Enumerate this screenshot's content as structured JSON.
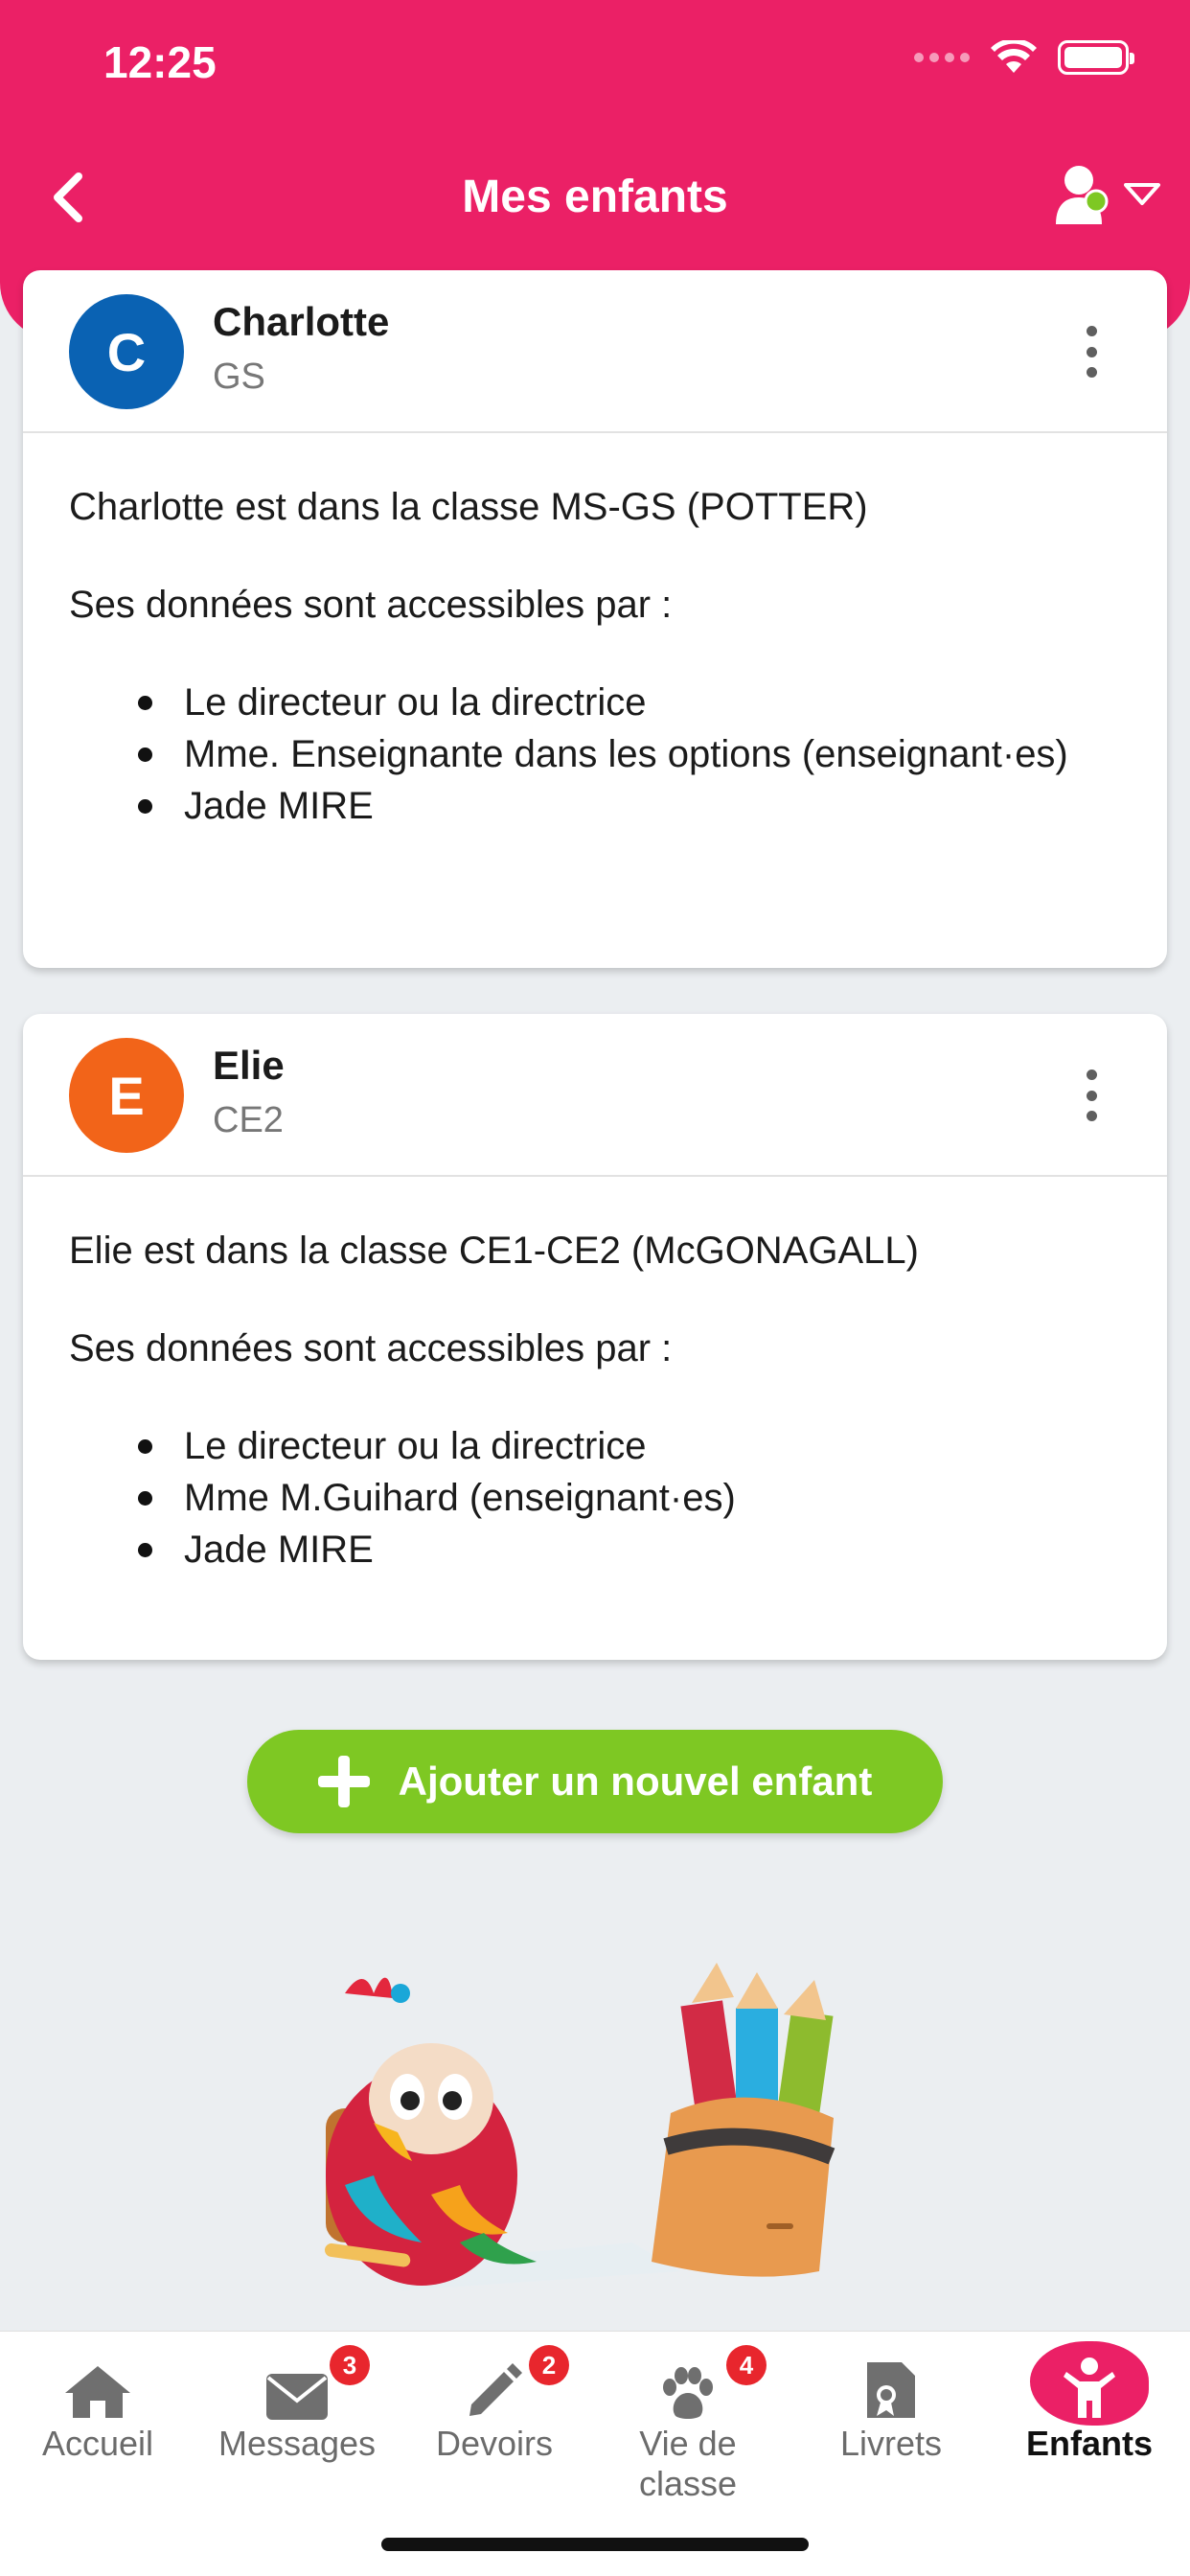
{
  "status_bar": {
    "time": "12:25"
  },
  "header": {
    "title": "Mes enfants",
    "back_icon": "chevron-left-icon",
    "profile_icon": "user-switch-icon"
  },
  "children": [
    {
      "initial": "C",
      "name": "Charlotte",
      "level": "GS",
      "avatar_color": "#0a62b3",
      "class_text": "Charlotte est dans la classe MS-GS (POTTER)",
      "access_title": "Ses données sont accessibles par :",
      "access_list": [
        "Le directeur ou la directrice",
        "Mme. Enseignante dans les options (enseignant·es)",
        "Jade MIRE"
      ]
    },
    {
      "initial": "E",
      "name": "Elie",
      "level": "CE2",
      "avatar_color": "#f26419",
      "class_text": "Elie est dans la classe CE1-CE2 (McGONAGALL)",
      "access_title": "Ses données sont accessibles par :",
      "access_list": [
        "Le directeur ou la directrice",
        "Mme M.Guihard (enseignant·es)",
        "Jade MIRE"
      ]
    }
  ],
  "add_button": {
    "label": "Ajouter un nouvel enfant",
    "color": "#7ec823"
  },
  "tabs": [
    {
      "label": "Accueil",
      "icon": "home-icon",
      "badge": ""
    },
    {
      "label": "Messages",
      "icon": "envelope-icon",
      "badge": "3"
    },
    {
      "label": "Devoirs",
      "icon": "pencil-icon",
      "badge": "2"
    },
    {
      "label": "Vie de classe",
      "icon": "paw-icon",
      "badge": "4"
    },
    {
      "label": "Livrets",
      "icon": "document-icon",
      "badge": ""
    },
    {
      "label": "Enfants",
      "icon": "child-icon",
      "badge": "",
      "active": true
    }
  ],
  "colors": {
    "brand": "#eb2066",
    "badge": "#e8262d",
    "background": "#ebeef1"
  }
}
